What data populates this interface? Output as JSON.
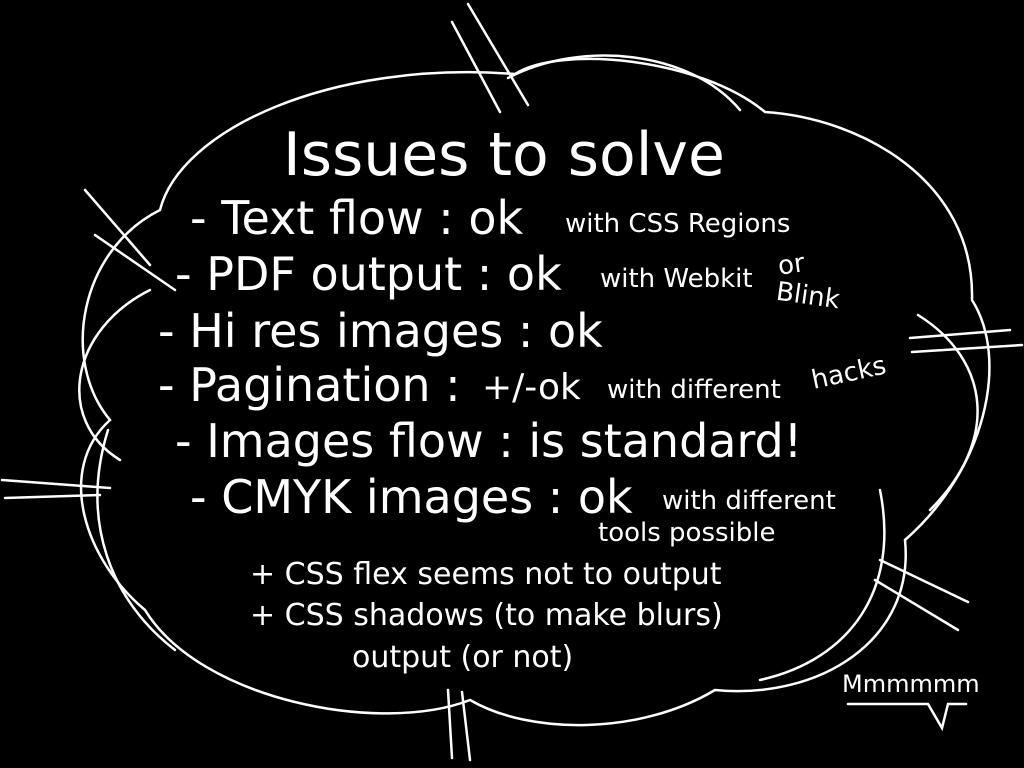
{
  "slide": {
    "title": "Issues to solve",
    "items": [
      {
        "main": "- Text flow : ok",
        "note": "with CSS Regions"
      },
      {
        "main": "- PDF output : ok",
        "note": "with Webkit",
        "extra1": "or",
        "extra2": "Blink"
      },
      {
        "main": "- Hi res images : ok"
      },
      {
        "main": "- Pagination :",
        "status": "+/-ok",
        "note": "with different",
        "extra": "hacks"
      },
      {
        "main": "- Images flow : is standard!"
      },
      {
        "main": "- CMYK images : ok",
        "note": "with different",
        "note2": "tools possible"
      }
    ],
    "extras": [
      "+ CSS flex seems not to output",
      "+ CSS shadows (to make blurs)",
      "output (or not)"
    ],
    "bubble": "Mmmmmm"
  },
  "colors": {
    "background": "#000000",
    "foreground": "#ffffff"
  }
}
